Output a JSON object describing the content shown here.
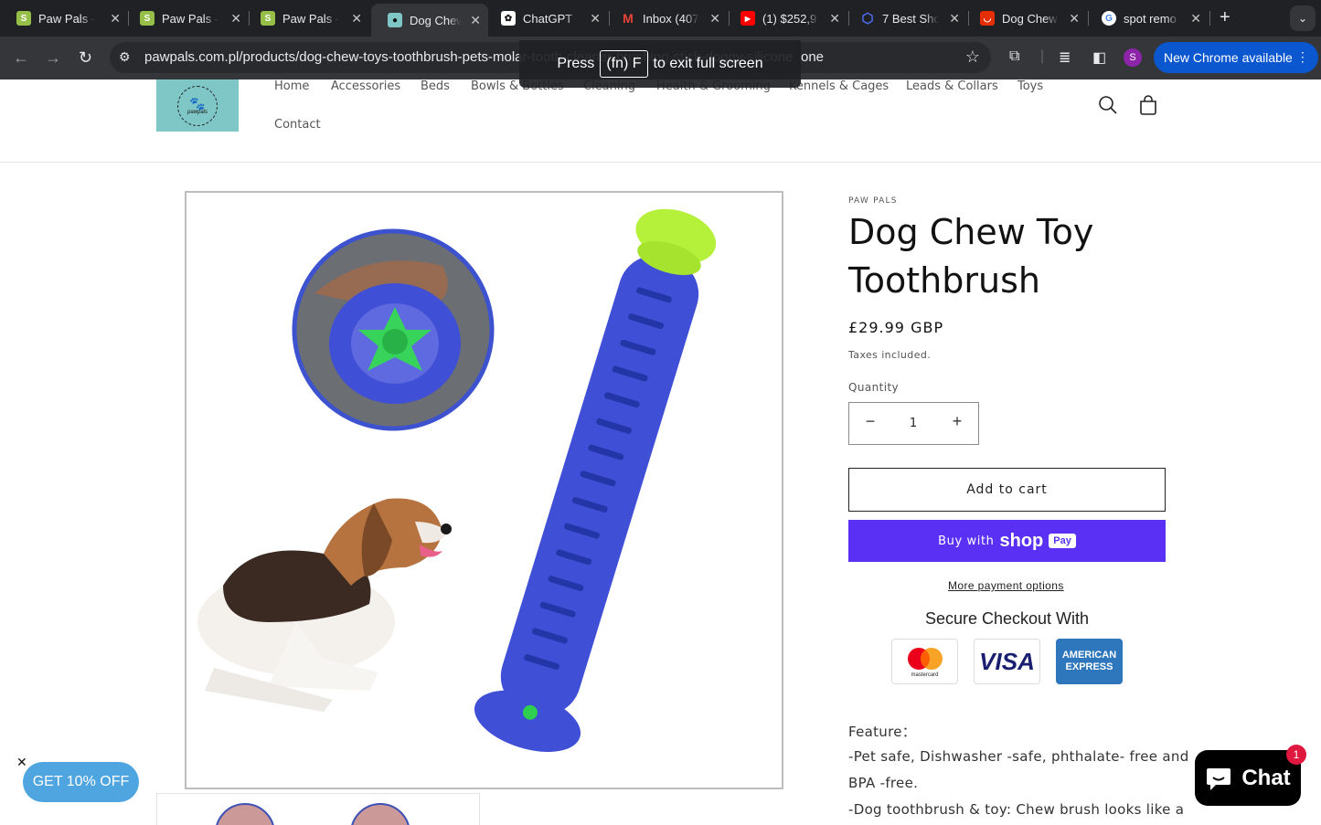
{
  "browser": {
    "tabs": [
      {
        "title": "Paw Pals -",
        "icon": "shopify-icon",
        "color": "#95bf47"
      },
      {
        "title": "Paw Pals -",
        "icon": "shopify-icon",
        "color": "#95bf47"
      },
      {
        "title": "Paw Pals -",
        "icon": "shopify-icon",
        "color": "#95bf47"
      },
      {
        "title": "Dog Chew",
        "icon": "pawpals-icon",
        "color": "#7fc6c6"
      },
      {
        "title": "ChatGPT",
        "icon": "openai-icon",
        "color": "#ffffff"
      },
      {
        "title": "Inbox (407",
        "icon": "gmail-icon",
        "color": "#ea4335"
      },
      {
        "title": "(1) $252,9",
        "icon": "youtube-icon",
        "color": "#ff0000"
      },
      {
        "title": "7 Best Sho",
        "icon": "hexagon-icon",
        "color": "#4f6ef7"
      },
      {
        "title": "Dog Chew",
        "icon": "aliexpress-icon",
        "color": "#e62e04"
      },
      {
        "title": "spot remo",
        "icon": "google-icon",
        "color": "#4285f4"
      }
    ],
    "close_glyph": "✕",
    "new_tab_glyph": "+",
    "url": "pawpals.com.pl/products/dog-chew-toys-toothbrush-pets-molar-tooth-cleaner-brushing-stick-doggy-silicone",
    "url_visible_end": "one",
    "profile_initial": "S",
    "update_label": "New Chrome available",
    "fullscreen": {
      "press": "Press",
      "key": "(fn) F",
      "rest": "to exit full screen"
    }
  },
  "header": {
    "logo_text": "pawpals",
    "nav": [
      "Home",
      "Accessories",
      "Beds",
      "Bowls & Bottles",
      "Cleaning",
      "Health & Grooming",
      "Kennels & Cages",
      "Leads & Collars",
      "Toys",
      "Contact"
    ]
  },
  "product": {
    "vendor": "PAW PALS",
    "title": "Dog Chew Toy Toothbrush",
    "price": "£29.99 GBP",
    "tax_note": "Taxes included.",
    "quantity_label": "Quantity",
    "quantity": "1",
    "minus": "−",
    "plus": "+",
    "add_to_cart": "Add to cart",
    "buy_with": "Buy with",
    "shop_brand": "shop",
    "shop_pay": "Pay",
    "more_payment": "More payment options",
    "secure_checkout": "Secure Checkout With",
    "cards": {
      "mastercard": "mastercard",
      "visa": "VISA",
      "amex_1": "AMERICAN",
      "amex_2": "EXPRESS"
    },
    "description": [
      "Feature：",
      "-Pet safe, Dishwasher -safe, phthalate- free and",
      "BPA -free.",
      "-Dog toothbrush & toy: Chew brush looks like a"
    ]
  },
  "widgets": {
    "discount": "GET 10% OFF",
    "discount_close": "✕",
    "chat": "Chat",
    "chat_badge": "1"
  },
  "colors": {
    "shop_pay": "#5a31f4",
    "discount": "#4ea5e0",
    "chrome_blue": "#0b57d0",
    "toy_blue": "#3f4fd6",
    "toy_green": "#b5f13b"
  }
}
